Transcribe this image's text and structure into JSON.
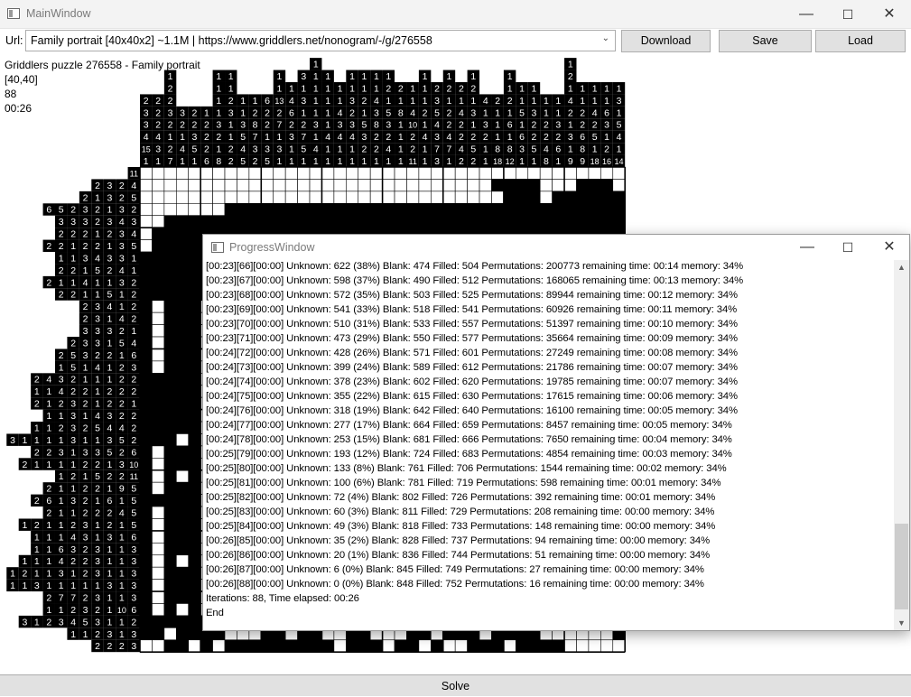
{
  "main_window": {
    "title": "MainWindow",
    "controls": {
      "minimize": "—",
      "maximize": "☐",
      "close": "✕"
    }
  },
  "toolbar": {
    "url_label": "Url:",
    "url_value": "Family portrait [40x40x2] ~1.1M | https://www.griddlers.net/nonogram/-/g/276558",
    "chevron": "⌄",
    "download_label": "Download",
    "save_label": "Save",
    "load_label": "Load"
  },
  "info": {
    "puzzle_title": "Griddlers puzzle 276558 - Family portrait",
    "size": "[40,40]",
    "iterations": "88",
    "elapsed": "00:26"
  },
  "nonogram": {
    "column_clues": [
      "2 3 3 4 15 1",
      "2 2 2 4 3 1",
      "1 2 2 3 2 1 2 7",
      "3 2 1 4 1",
      "2 2 3 5 1",
      "1 2 2 2 6",
      "1 1 1 1 3 2 1 8",
      "1 1 2 3 1 1 2 2",
      "1 1 3 5 4 5",
      "1 2 8 7 3 2",
      "6 2 2 1 3 5",
      "1 1 13 2 7 1 3 1",
      "1 4 6 2 3 1 1",
      "3 1 3 1 2 7 5 1",
      "1 1 1 1 1 3 1 4 1",
      "1 1 1 1 1 4 1 1",
      "1 1 4 3 4 1 1",
      "1 1 3 2 3 4 1 1",
      "1 1 2 1 5 3 2 1",
      "1 1 4 3 8 2 2 1",
      "1 2 1 5 3 2 4 1",
      "2 1 8 1 1 1 1",
      "1 1 4 10 2 2 11",
      "1 1 1 2 1 4 1 1",
      "2 3 5 4 3 7 3",
      "1 2 1 2 2 4 7 1",
      "2 1 4 2 2 4 2",
      "1 2 1 3 1 2 5 2",
      "4 1 3 2 1 1",
      "2 1 1 1 8 18",
      "1 1 2 1 6 1 8 12",
      "1 1 5 1 6 3 1",
      "1 1 3 2 2 5 1",
      "1 1 2 2 4 8",
      "1 1 3 2 6 1",
      "1 2 1 4 2 1 3 1 9",
      "1 1 2 2 6 8 9",
      "1 1 4 2 5 1 18",
      "1 1 6 3 1 2 16",
      "1 3 1 5 4 1 14"
    ],
    "row_clues": [
      "11",
      "2 3 2 4",
      "2 1 3 2 5",
      "6 5 2 3 2 1 3 2",
      "3 3 3 2 3 4 3",
      "2 2 2 1 2 3 4",
      "2 2 1 2 2 1 3 5",
      "1 1 3 4 3 3 1",
      "2 2 1 5 2 4 1",
      "2 1 1 4 1 1 3 2",
      "2 2 1 1 5 1 2",
      "2 3 4 1 2",
      "2 3 1 4 2",
      "3 3 3 2 1",
      "2 3 3 1 5 4",
      "2 5 3 2 2 1 6",
      "1 5 1 4 1 2 3",
      "2 4 3 2 1 1 1 2 2",
      "1 1 4 2 2 1 2 2 2",
      "2 1 2 3 2 1 2 2 1",
      "1 1 3 1 4 3 2 2",
      "1 1 2 3 2 5 4 4 2",
      "3 1 1 1 1 3 1 1 3 5 2",
      "2 2 3 1 3 3 5 2 6",
      "2 1 1 1 1 2 2 1 3 10",
      "1 2 1 5 2 2 11",
      "2 1 1 2 2 1 9 5",
      "2 6 1 3 2 1 6 1 5",
      "2 1 1 2 2 2 4 5",
      "1 2 1 1 2 3 1 2 1 5",
      "1 1 1 4 3 1 3 1 6",
      "1 1 6 3 2 3 1 1 3",
      "1 1 1 4 2 2 3 1 1 3",
      "1 2 1 1 3 1 2 3 1 1 3",
      "1 1 3 1 1 1 1 1 3 1 3",
      "2 7 7 2 3 1 1 3",
      "1 1 2 3 2 1 10 6",
      "3 1 2 3 4 5 3 1 1 2",
      "1 1 2 3 1 3",
      "2 2 2 3"
    ],
    "rows": [
      "0000000000000000000000000000000000000000",
      "0000000000000000000000000000011110001110",
      "0000000000000000000000000000001110111111",
      "0000000111111111111111111111111111111111",
      "0011111111111111111111111111111111111111",
      "0111111111111111111111111111111111111111",
      "0111111111111111111111111111111111111111",
      "1111111111111111111111111111111111111111",
      "1111111111111111111111111111111111111111",
      "1111111111111111111111111111111111111111",
      "1111111111111111111111111111111111111111",
      "1011101000000000000000000000000000000000",
      "1011101000000000000000000000000000000000",
      "1011100000000000000000000000000000000000",
      "1011100000000000000000000000000000000000",
      "1011101100000000000000000000000000000000",
      "1011100000000000000000000000000000000000",
      "1111100000000000000000000000000000000000",
      "1111101000000000000000000000000000000000",
      "1111101000000000000000000000000000000000",
      "1111101000000000000000000000000000000000",
      "1111101000000000000000000000000000000000",
      "1110101000000000000000000000000000000000",
      "1011101000000000000000000000000000000000",
      "1011101000000000000000000000000000000000",
      "1010101000000000000000000000000000000000",
      "1011101000000000000000000000000000000000",
      "1111101000000000000000000000000000000000",
      "1011101000000000000000000000000000000000",
      "1011101000000000000000000000000000000000",
      "1011101000000000000000000000000000000000",
      "1011101000000000000000000000000000000000",
      "1010101000000000000000000000000000000000",
      "1011101000000000000000000000000000000000",
      "1011101000000000000000000000000000000000",
      "1011101000000000000000000000000000000000",
      "1010101000000000000000000000000000000000",
      "1111111111100010100001101111011110101000",
      "1101111000110110011000110111011110000001",
      "0011010111111111011101101001110111100000"
    ]
  },
  "progress_window": {
    "title": "ProgressWindow",
    "controls": {
      "minimize": "—",
      "maximize": "☐",
      "close": "✕"
    },
    "scroll_up": "▲",
    "scroll_down": "▼",
    "log_lines": [
      "[00:23][66][00:00] Unknown: 622 (38%) Blank: 474 Filled: 504 Permutations: 200773 remaining time: 00:14 memory: 34%",
      "[00:23][67][00:00] Unknown: 598 (37%) Blank: 490 Filled: 512 Permutations: 168065 remaining time: 00:13 memory: 34%",
      "[00:23][68][00:00] Unknown: 572 (35%) Blank: 503 Filled: 525 Permutations: 89944 remaining time: 00:12 memory: 34%",
      "[00:23][69][00:00] Unknown: 541 (33%) Blank: 518 Filled: 541 Permutations: 60926 remaining time: 00:11 memory: 34%",
      "[00:23][70][00:00] Unknown: 510 (31%) Blank: 533 Filled: 557 Permutations: 51397 remaining time: 00:10 memory: 34%",
      "[00:23][71][00:00] Unknown: 473 (29%) Blank: 550 Filled: 577 Permutations: 35664 remaining time: 00:09 memory: 34%",
      "[00:24][72][00:00] Unknown: 428 (26%) Blank: 571 Filled: 601 Permutations: 27249 remaining time: 00:08 memory: 34%",
      "[00:24][73][00:00] Unknown: 399 (24%) Blank: 589 Filled: 612 Permutations: 21786 remaining time: 00:07 memory: 34%",
      "[00:24][74][00:00] Unknown: 378 (23%) Blank: 602 Filled: 620 Permutations: 19785 remaining time: 00:07 memory: 34%",
      "[00:24][75][00:00] Unknown: 355 (22%) Blank: 615 Filled: 630 Permutations: 17615 remaining time: 00:06 memory: 34%",
      "[00:24][76][00:00] Unknown: 318 (19%) Blank: 642 Filled: 640 Permutations: 16100 remaining time: 00:05 memory: 34%",
      "[00:24][77][00:00] Unknown: 277 (17%) Blank: 664 Filled: 659 Permutations: 8457 remaining time: 00:05 memory: 34%",
      "[00:24][78][00:00] Unknown: 253 (15%) Blank: 681 Filled: 666 Permutations: 7650 remaining time: 00:04 memory: 34%",
      "[00:25][79][00:00] Unknown: 193 (12%) Blank: 724 Filled: 683 Permutations: 4854 remaining time: 00:03 memory: 34%",
      "[00:25][80][00:00] Unknown: 133 (8%) Blank: 761 Filled: 706 Permutations: 1544 remaining time: 00:02 memory: 34%",
      "[00:25][81][00:00] Unknown: 100 (6%) Blank: 781 Filled: 719 Permutations: 598 remaining time: 00:01 memory: 34%",
      "[00:25][82][00:00] Unknown: 72 (4%) Blank: 802 Filled: 726 Permutations: 392 remaining time: 00:01 memory: 34%",
      "[00:25][83][00:00] Unknown: 60 (3%) Blank: 811 Filled: 729 Permutations: 208 remaining time: 00:00 memory: 34%",
      "[00:25][84][00:00] Unknown: 49 (3%) Blank: 818 Filled: 733 Permutations: 148 remaining time: 00:00 memory: 34%",
      "[00:26][85][00:00] Unknown: 35 (2%) Blank: 828 Filled: 737 Permutations: 94 remaining time: 00:00 memory: 34%",
      "[00:26][86][00:00] Unknown: 20 (1%) Blank: 836 Filled: 744 Permutations: 51 remaining time: 00:00 memory: 34%",
      "[00:26][87][00:00] Unknown: 6 (0%) Blank: 845 Filled: 749 Permutations: 27 remaining time: 00:00 memory: 34%",
      "[00:26][88][00:00] Unknown: 0 (0%) Blank: 848 Filled: 752 Permutations: 16 remaining time: 00:00 memory: 34%",
      "Iterations: 88, Time elapsed: 00:26",
      "End"
    ]
  },
  "footer": {
    "solve_label": "Solve"
  },
  "colors": {
    "filled": "#000000",
    "blank": "#ffffff",
    "grid": "#000000"
  }
}
